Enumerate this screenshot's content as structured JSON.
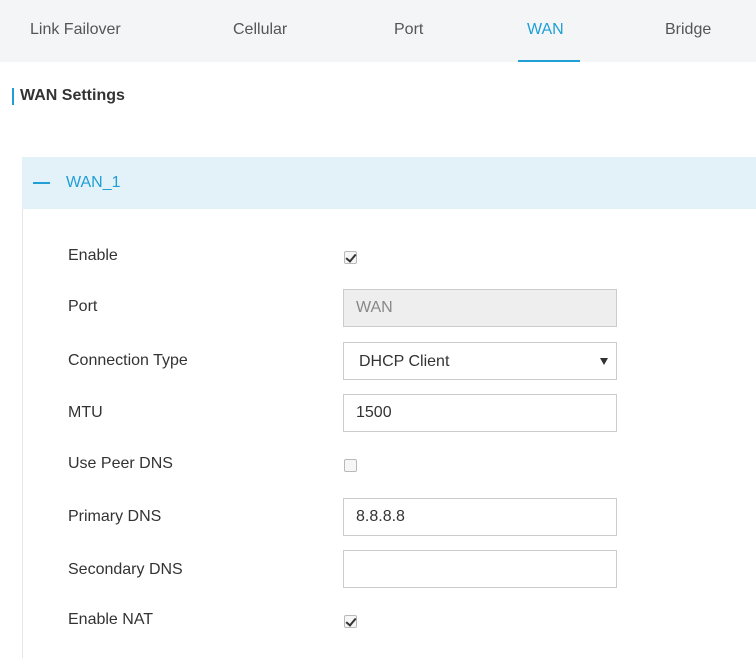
{
  "tabs": [
    {
      "label": "Link Failover",
      "active": false
    },
    {
      "label": "Cellular",
      "active": false
    },
    {
      "label": "Port",
      "active": false
    },
    {
      "label": "WAN",
      "active": true
    },
    {
      "label": "Bridge",
      "active": false
    }
  ],
  "section": {
    "title": "WAN Settings"
  },
  "panel": {
    "title": "WAN_1",
    "collapse_icon": "minus-icon"
  },
  "form": {
    "enable": {
      "label": "Enable",
      "checked": true
    },
    "port": {
      "label": "Port",
      "value": "WAN",
      "disabled": true
    },
    "connection_type": {
      "label": "Connection Type",
      "value": "DHCP Client"
    },
    "mtu": {
      "label": "MTU",
      "value": "1500"
    },
    "use_peer_dns": {
      "label": "Use Peer DNS",
      "checked": false
    },
    "primary_dns": {
      "label": "Primary DNS",
      "value": "8.8.8.8"
    },
    "secondary_dns": {
      "label": "Secondary DNS",
      "value": ""
    },
    "enable_nat": {
      "label": "Enable NAT",
      "checked": true
    }
  },
  "colors": {
    "accent": "#1f9fd6",
    "tab_bar_bg": "#f4f5f7",
    "panel_header_bg": "#e3f1f9",
    "disabled_input_bg": "#eeeeee"
  }
}
